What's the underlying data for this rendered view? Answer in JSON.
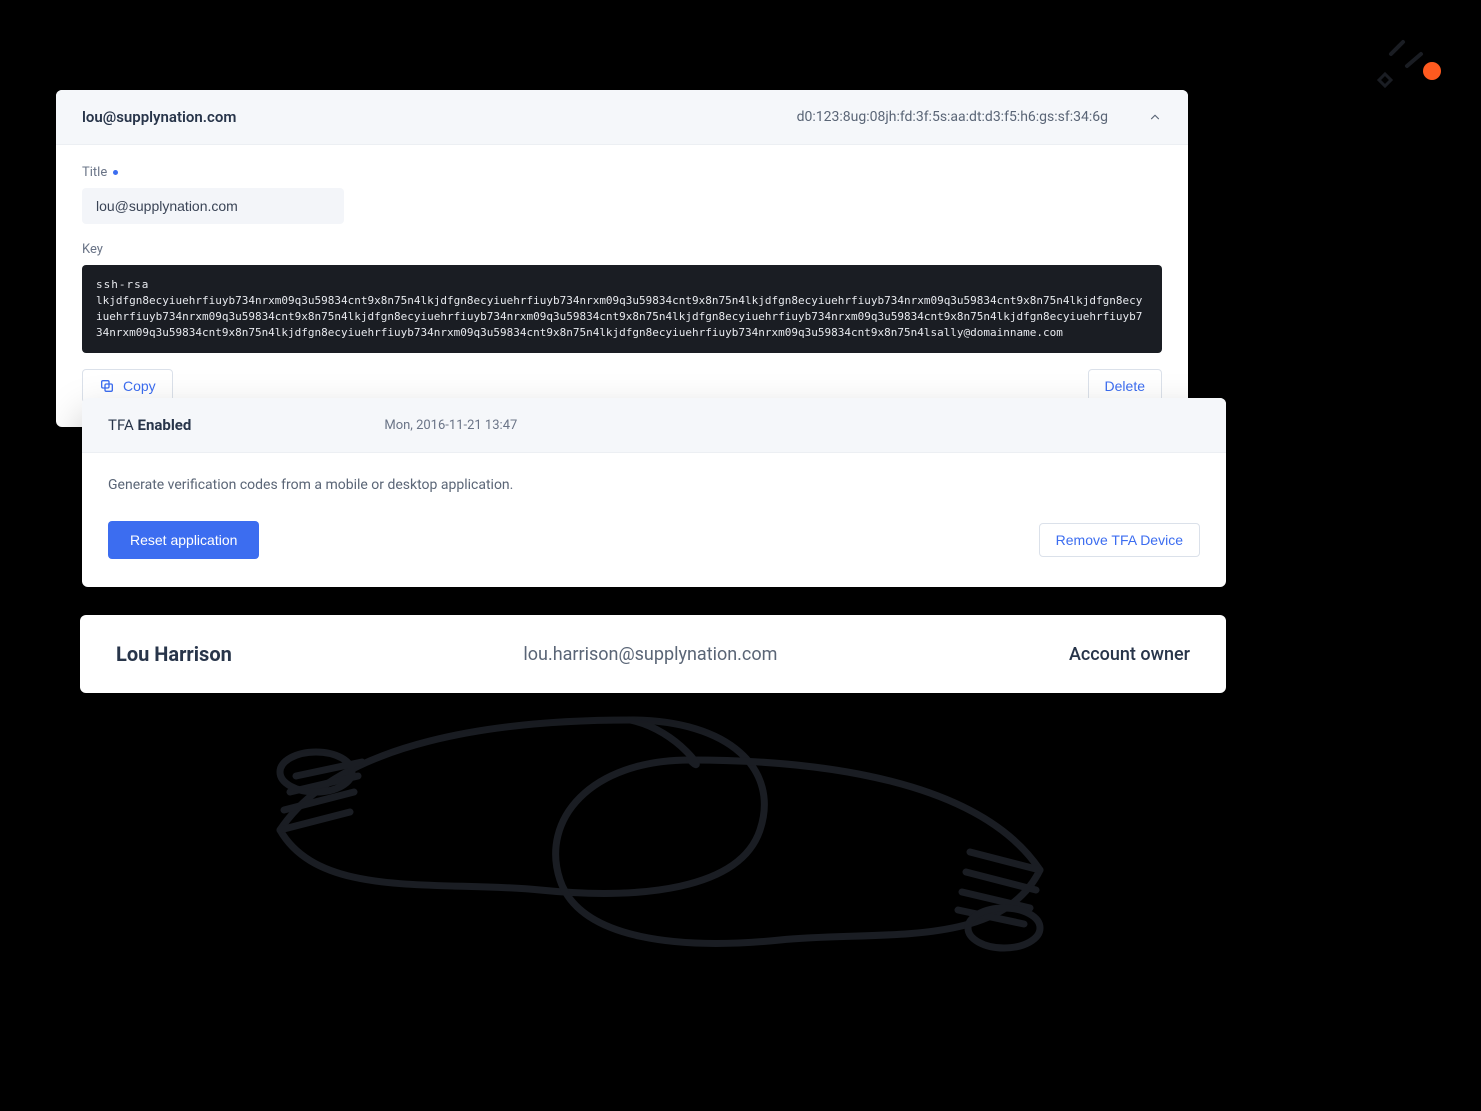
{
  "embellish": {},
  "ssh": {
    "header": {
      "email": "lou@supplynation.com",
      "fingerprint": "d0:123:8ug:08jh:fd:3f:5s:aa:dt:d3:f5:h6:gs:sf:34:6g"
    },
    "title_label": "Title",
    "title_value": "lou@supplynation.com",
    "key_label": "Key",
    "key_prefix": "ssh-rsa",
    "key_body": "lkjdfgn8ecyiuehrfiuyb734nrxm09q3u59834cnt9x8n75n4lkjdfgn8ecyiuehrfiuyb734nrxm09q3u59834cnt9x8n75n4lkjdfgn8ecyiuehrfiuyb734nrxm09q3u59834cnt9x8n75n4lkjdfgn8ecyiuehrfiuyb734nrxm09q3u59834cnt9x8n75n4lkjdfgn8ecyiuehrfiuyb734nrxm09q3u59834cnt9x8n75n4lkjdfgn8ecyiuehrfiuyb734nrxm09q3u59834cnt9x8n75n4lkjdfgn8ecyiuehrfiuyb734nrxm09q3u59834cnt9x8n75n4lkjdfgn8ecyiuehrfiuyb734nrxm09q3u59834cnt9x8n75n4lkjdfgn8ecyiuehrfiuyb734nrxm09q3u59834cnt9x8n75n4lsally@domainname.com",
    "copy_label": "Copy",
    "delete_label": "Delete"
  },
  "tfa": {
    "title_thin": "TFA ",
    "title_bold": "Enabled",
    "timestamp": "Mon, 2016-11-21  13:47",
    "description": "Generate verification codes from a mobile or desktop application.",
    "reset_label": "Reset application",
    "remove_label": "Remove TFA Device"
  },
  "user": {
    "name": "Lou Harrison",
    "email": "lou.harrison@supplynation.com",
    "role": "Account owner"
  }
}
